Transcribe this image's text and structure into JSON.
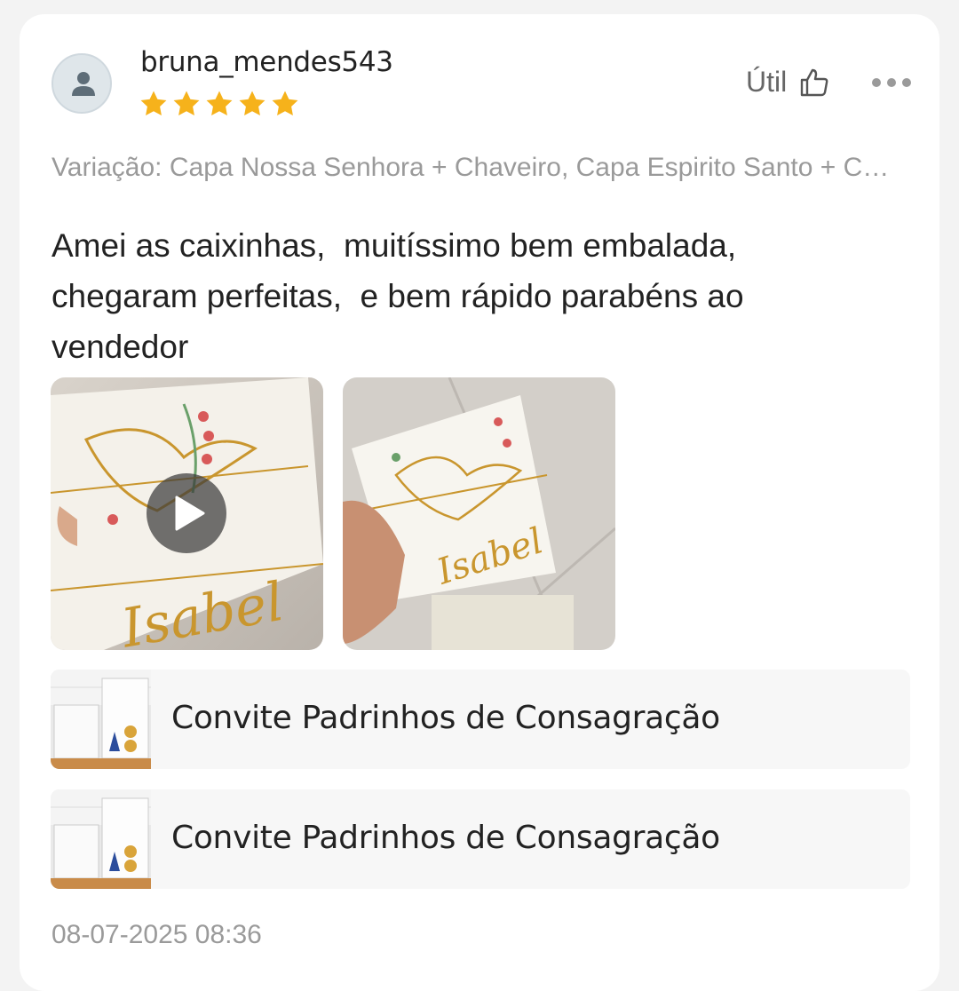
{
  "review": {
    "username": "bruna_mendes543",
    "rating": 5,
    "useful_label": "Útil",
    "variation": "Variação: Capa Nossa Senhora + Chaveiro, Capa Espirito Santo + Chaveiro",
    "text": "Amei as caixinhas,  muitíssimo bem embalada,\nchegaram perfeitas,  e bem rápido parabéns ao\nvendedor",
    "media": [
      {
        "type": "video",
        "caption": "Isabel"
      },
      {
        "type": "image",
        "caption": "Isabel"
      }
    ],
    "products": [
      {
        "title": "Convite Padrinhos de Consagração"
      },
      {
        "title": "Convite Padrinhos de Consagração"
      }
    ],
    "date": "08-07-2025 08:36"
  },
  "colors": {
    "star": "#f6b21b",
    "muted_text": "#9a9a9a",
    "gold": "#c9962e"
  },
  "icons": {
    "avatar": "user-icon",
    "useful": "thumbs-up-icon",
    "more": "more-dots-icon",
    "play": "play-icon"
  }
}
